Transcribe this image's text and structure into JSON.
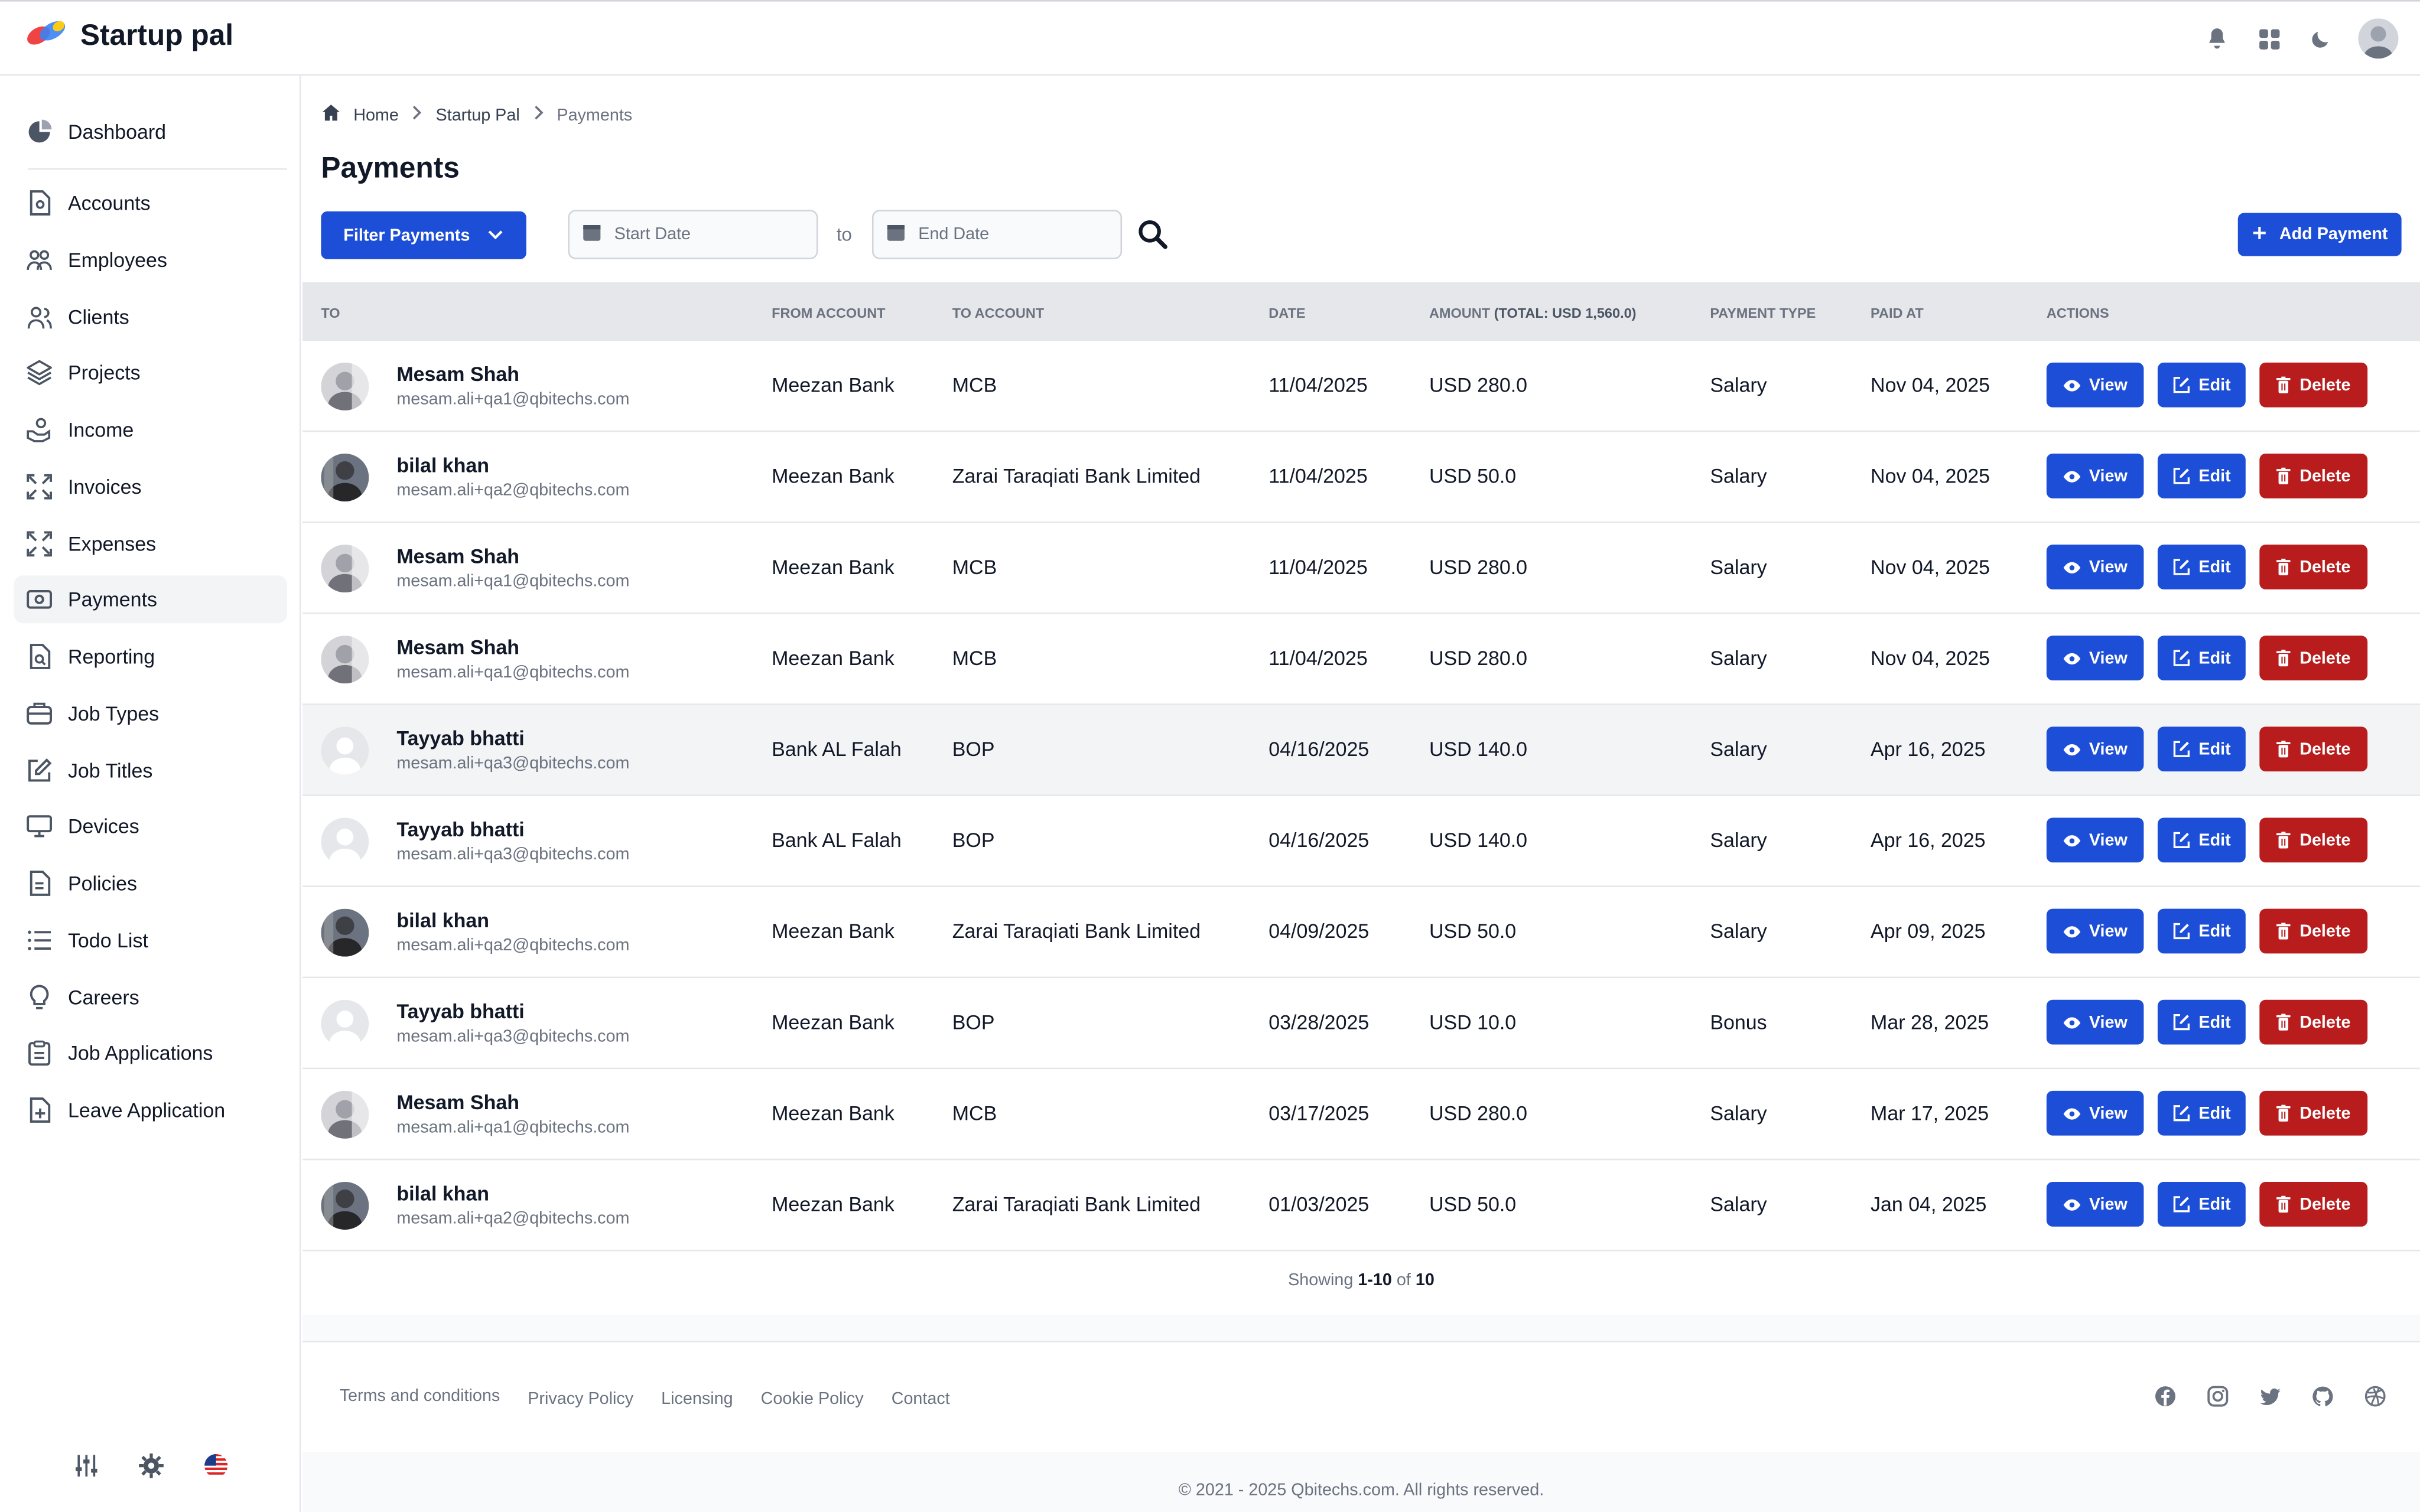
{
  "app": {
    "title": "Startup pal"
  },
  "breadcrumb": {
    "home": "Home",
    "section": "Startup Pal",
    "current": "Payments"
  },
  "page": {
    "title": "Payments"
  },
  "toolbar": {
    "filter_label": "Filter Payments",
    "start_placeholder": "Start Date",
    "to_label": "to",
    "end_placeholder": "End Date",
    "add_label": "Add Payment"
  },
  "sidebar": {
    "items": [
      {
        "label": "Dashboard",
        "icon": "pie-chart-icon"
      },
      {
        "label": "Accounts",
        "icon": "document-icon"
      },
      {
        "label": "Employees",
        "icon": "users-icon"
      },
      {
        "label": "Clients",
        "icon": "user-group-icon"
      },
      {
        "label": "Projects",
        "icon": "layers-icon"
      },
      {
        "label": "Income",
        "icon": "hand-coin-icon"
      },
      {
        "label": "Invoices",
        "icon": "expand-icon"
      },
      {
        "label": "Expenses",
        "icon": "expand-icon"
      },
      {
        "label": "Payments",
        "icon": "cash-icon"
      },
      {
        "label": "Reporting",
        "icon": "report-icon"
      },
      {
        "label": "Job Types",
        "icon": "briefcase-icon"
      },
      {
        "label": "Job Titles",
        "icon": "edit-icon"
      },
      {
        "label": "Devices",
        "icon": "monitor-icon"
      },
      {
        "label": "Policies",
        "icon": "file-icon"
      },
      {
        "label": "Todo List",
        "icon": "list-icon"
      },
      {
        "label": "Careers",
        "icon": "lightbulb-icon"
      },
      {
        "label": "Job Applications",
        "icon": "clipboard-icon"
      },
      {
        "label": "Leave Application",
        "icon": "file-plus-icon"
      }
    ]
  },
  "table": {
    "headers": {
      "to": "TO",
      "from_account": "FROM ACCOUNT",
      "to_account": "TO ACCOUNT",
      "date": "DATE",
      "amount": "AMOUNT",
      "amount_total": "(TOTAL: USD 1,560.0)",
      "payment_type": "PAYMENT TYPE",
      "paid_at": "PAID AT",
      "actions": "ACTIONS"
    },
    "actions": {
      "view": "View",
      "edit": "Edit",
      "delete": "Delete"
    },
    "rows": [
      {
        "name": "Mesam Shah",
        "email": "mesam.ali+qa1@qbitechs.com",
        "from": "Meezan Bank",
        "to": "MCB",
        "date": "11/04/2025",
        "amount": "USD 280.0",
        "type": "Salary",
        "paid_at": "Nov 04, 2025",
        "avatar": "photo-gray"
      },
      {
        "name": "bilal khan",
        "email": "mesam.ali+qa2@qbitechs.com",
        "from": "Meezan Bank",
        "to": "Zarai Taraqiati Bank Limited",
        "date": "11/04/2025",
        "amount": "USD 50.0",
        "type": "Salary",
        "paid_at": "Nov 04, 2025",
        "avatar": "photo-dark"
      },
      {
        "name": "Mesam Shah",
        "email": "mesam.ali+qa1@qbitechs.com",
        "from": "Meezan Bank",
        "to": "MCB",
        "date": "11/04/2025",
        "amount": "USD 280.0",
        "type": "Salary",
        "paid_at": "Nov 04, 2025",
        "avatar": "photo-gray"
      },
      {
        "name": "Mesam Shah",
        "email": "mesam.ali+qa1@qbitechs.com",
        "from": "Meezan Bank",
        "to": "MCB",
        "date": "11/04/2025",
        "amount": "USD 280.0",
        "type": "Salary",
        "paid_at": "Nov 04, 2025",
        "avatar": "photo-gray"
      },
      {
        "name": "Tayyab bhatti",
        "email": "mesam.ali+qa3@qbitechs.com",
        "from": "Bank AL Falah",
        "to": "BOP",
        "date": "04/16/2025",
        "amount": "USD 140.0",
        "type": "Salary",
        "paid_at": "Apr 16, 2025",
        "avatar": "placeholder"
      },
      {
        "name": "Tayyab bhatti",
        "email": "mesam.ali+qa3@qbitechs.com",
        "from": "Bank AL Falah",
        "to": "BOP",
        "date": "04/16/2025",
        "amount": "USD 140.0",
        "type": "Salary",
        "paid_at": "Apr 16, 2025",
        "avatar": "placeholder"
      },
      {
        "name": "bilal khan",
        "email": "mesam.ali+qa2@qbitechs.com",
        "from": "Meezan Bank",
        "to": "Zarai Taraqiati Bank Limited",
        "date": "04/09/2025",
        "amount": "USD 50.0",
        "type": "Salary",
        "paid_at": "Apr 09, 2025",
        "avatar": "photo-dark"
      },
      {
        "name": "Tayyab bhatti",
        "email": "mesam.ali+qa3@qbitechs.com",
        "from": "Meezan Bank",
        "to": "BOP",
        "date": "03/28/2025",
        "amount": "USD 10.0",
        "type": "Bonus",
        "paid_at": "Mar 28, 2025",
        "avatar": "placeholder"
      },
      {
        "name": "Mesam Shah",
        "email": "mesam.ali+qa1@qbitechs.com",
        "from": "Meezan Bank",
        "to": "MCB",
        "date": "03/17/2025",
        "amount": "USD 280.0",
        "type": "Salary",
        "paid_at": "Mar 17, 2025",
        "avatar": "photo-gray"
      },
      {
        "name": "bilal khan",
        "email": "mesam.ali+qa2@qbitechs.com",
        "from": "Meezan Bank",
        "to": "Zarai Taraqiati Bank Limited",
        "date": "01/03/2025",
        "amount": "USD 50.0",
        "type": "Salary",
        "paid_at": "Jan 04, 2025",
        "avatar": "photo-dark"
      }
    ],
    "highlighted_row": 4
  },
  "pagination": {
    "prefix": "Showing",
    "range": "1-10",
    "of": "of",
    "total": "10"
  },
  "footer": {
    "links": [
      "Terms and conditions",
      "Privacy Policy",
      "Licensing",
      "Cookie Policy",
      "Contact"
    ],
    "social": [
      "facebook-icon",
      "instagram-icon",
      "twitter-icon",
      "github-icon",
      "dribbble-icon"
    ],
    "copyright": "© 2021 - 2025 Qbitechs.com. All rights reserved."
  },
  "colors": {
    "primary": "#1d4ed8",
    "danger": "#b91c1c",
    "header_bg": "#e5e7eb"
  }
}
